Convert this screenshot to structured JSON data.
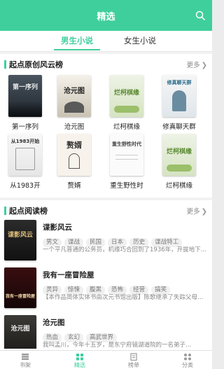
{
  "header": {
    "title": "精选"
  },
  "tabs": [
    {
      "label": "男生小说"
    },
    {
      "label": "女生小说"
    }
  ],
  "section1": {
    "title": "起点原创风云榜",
    "more": "更多",
    "books": [
      {
        "title": "第一序列",
        "cover_text": "第一序列"
      },
      {
        "title": "沧元图",
        "cover_text": "沧元图"
      },
      {
        "title": "烂柯棋缘",
        "cover_text": "烂柯棋缘"
      },
      {
        "title": "修真聊天群",
        "cover_text": "修真聊天群"
      },
      {
        "title": "从1983开",
        "cover_text": "从1983开始"
      },
      {
        "title": "赘婿",
        "cover_text": "赘婿"
      },
      {
        "title": "重生野性时",
        "cover_text": "重生野性时代"
      },
      {
        "title": "烂柯棋缘",
        "cover_text": "烂柯棋缘"
      }
    ]
  },
  "section2": {
    "title": "起点阅读榜",
    "more": "更多",
    "items": [
      {
        "title": "谍影风云",
        "tags": [
          "男文",
          "谍战",
          "民国",
          "日本",
          "历史",
          "谍战特工"
        ],
        "desc": "一个平凡普通的公务员，机缘巧合回到了1936年，开拔地下...",
        "cover_text": "谍影风云"
      },
      {
        "title": "我有一座冒险屋",
        "tags": [
          "灵异",
          "惊悚",
          "腹黑",
          "恐怖",
          "经营",
          "搞笑"
        ],
        "desc": "【本作品简体实体书由次元书馆出版】陈歌继承了失踪父母留下...",
        "cover_text": "我有一座冒险屋"
      },
      {
        "title": "沧元图",
        "tags": [
          "热血",
          "玄幻",
          "高武世界"
        ],
        "desc": "我叫孟川，今年十五岁，是东宁府镜湖道院的一名弟子...",
        "cover_text": "沧元图"
      }
    ]
  },
  "tabbar": [
    {
      "label": "书架"
    },
    {
      "label": "精选"
    },
    {
      "label": "榜单"
    },
    {
      "label": "分类"
    }
  ]
}
